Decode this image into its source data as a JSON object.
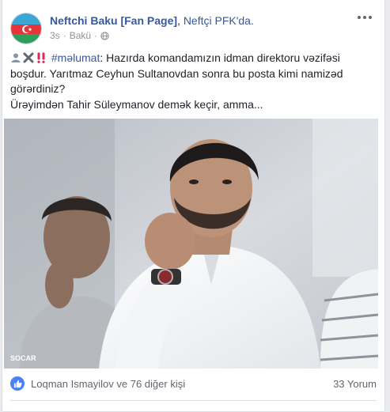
{
  "post": {
    "author": "Neftchi Baku [Fan Page]",
    "separator": ",",
    "page": "Neftçi PFK'da.",
    "time": "3s",
    "dot": "·",
    "location": "Bakü",
    "text": {
      "hashtag": "#məlumat",
      "line1_rest": ": Hazırda komandamızın idman direktoru vəzifəsi boşdur. Yarıtmaz Ceyhun Sultanovdan sonra bu posta kimi namizəd görərdiniz?",
      "line2": "Ürəyimdən Tahir Süleymanov demək keçir, amma..."
    },
    "photo": {
      "watermark_socar": "SOCAR"
    },
    "footer": {
      "likers": "Loqman Ismayilov ve 76 diğer kişi",
      "comments": "33 Yorum"
    }
  },
  "icons": [
    "avatar-flag",
    "globe-icon",
    "more-options-icon",
    "person-emoji",
    "cross-emoji",
    "double-exclamation-emoji",
    "like-icon"
  ],
  "colors": {
    "link": "#385898",
    "meta": "#90949c",
    "like_blue": "#4a82f5"
  }
}
